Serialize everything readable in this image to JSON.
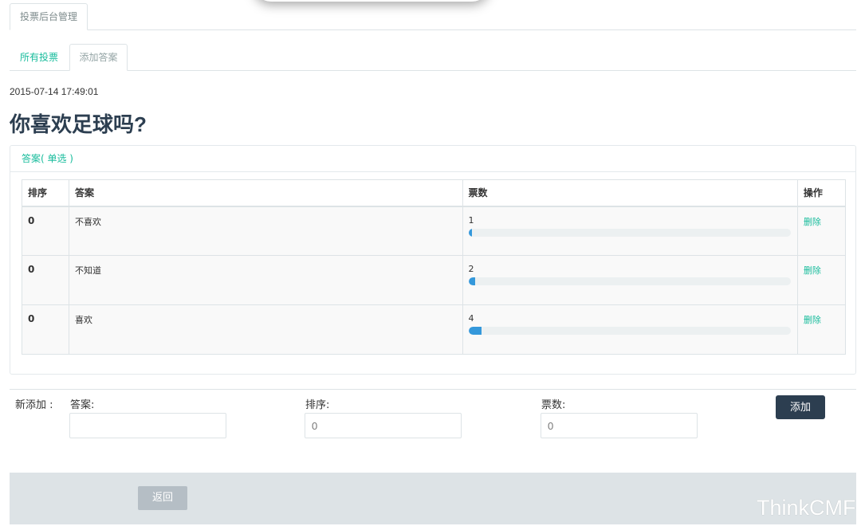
{
  "header": {
    "tab_label": "投票后台管理"
  },
  "subnav": {
    "all_votes": "所有投票",
    "add_answer": "添加答案"
  },
  "vote": {
    "date": "2015-07-14 17:49:01",
    "question": "你喜欢足球吗?"
  },
  "panel": {
    "title": "答案( 单选 )"
  },
  "table": {
    "headers": {
      "rank": "排序",
      "answer": "答案",
      "votes": "票数",
      "action": "操作"
    },
    "rows": [
      {
        "rank": "0",
        "answer": "不喜欢",
        "votes": "1",
        "progress": 0.01,
        "action": "删除"
      },
      {
        "rank": "0",
        "answer": "不知道",
        "votes": "2",
        "progress": 0.02,
        "action": "删除"
      },
      {
        "rank": "0",
        "answer": "喜欢",
        "votes": "4",
        "progress": 0.04,
        "action": "删除"
      }
    ]
  },
  "add_form": {
    "label": "新添加 :",
    "answer_label": "答案:",
    "answer_value": "",
    "rank_label": "排序:",
    "rank_placeholder": "0",
    "votes_label": "票数:",
    "votes_placeholder": "0",
    "submit": "添加"
  },
  "footer": {
    "back": "返回",
    "watermark": "ThinkCMF"
  },
  "colors": {
    "accent": "#18bc9c",
    "primary": "#2c3e50",
    "bar": "#3498db"
  }
}
